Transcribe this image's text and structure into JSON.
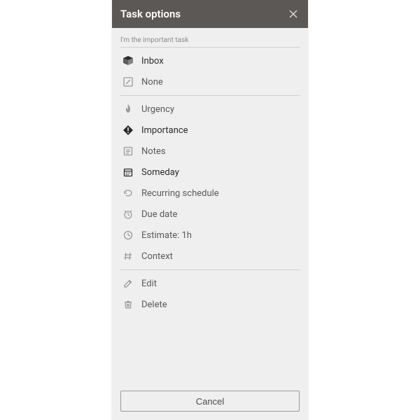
{
  "header": {
    "title": "Task options"
  },
  "task": {
    "name": "I'm the important task"
  },
  "groups": [
    {
      "items": [
        {
          "id": "inbox",
          "label": "Inbox",
          "dark": true
        },
        {
          "id": "project-none",
          "label": "None",
          "dark": false
        }
      ]
    },
    {
      "items": [
        {
          "id": "urgency",
          "label": "Urgency",
          "dark": false
        },
        {
          "id": "importance",
          "label": "Importance",
          "dark": true
        },
        {
          "id": "notes",
          "label": "Notes",
          "dark": false
        },
        {
          "id": "someday",
          "label": "Someday",
          "dark": true
        },
        {
          "id": "recurring",
          "label": "Recurring schedule",
          "dark": false
        },
        {
          "id": "due-date",
          "label": "Due date",
          "dark": false
        },
        {
          "id": "estimate",
          "label": "Estimate: 1h",
          "dark": false
        },
        {
          "id": "context",
          "label": "Context",
          "dark": false
        }
      ]
    },
    {
      "items": [
        {
          "id": "edit",
          "label": "Edit",
          "dark": false
        },
        {
          "id": "delete",
          "label": "Delete",
          "dark": false
        }
      ]
    }
  ],
  "footer": {
    "cancel": "Cancel"
  }
}
